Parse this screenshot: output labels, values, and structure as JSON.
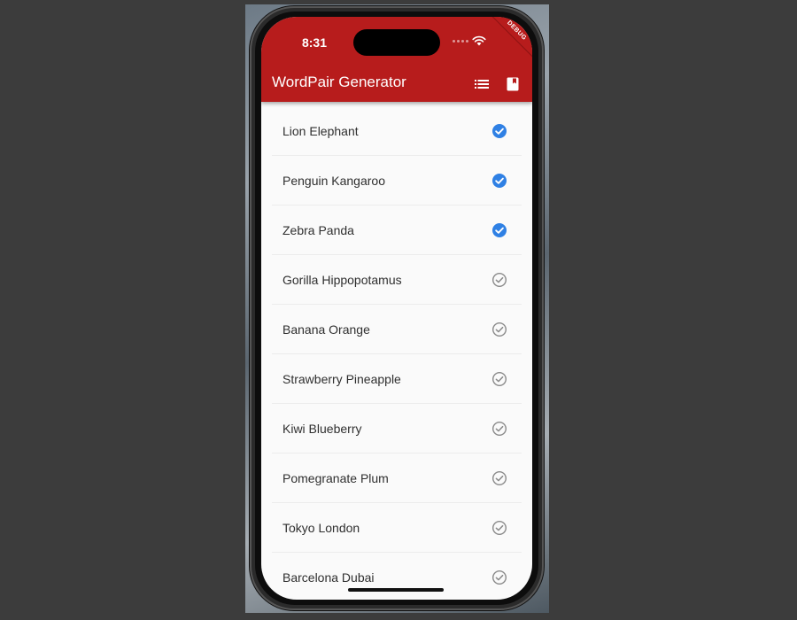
{
  "status": {
    "time": "8:31"
  },
  "debug_banner": "DEBUG",
  "app_bar": {
    "title": "WordPair Generator",
    "actions": [
      {
        "name": "list-icon"
      },
      {
        "name": "book-icon"
      }
    ]
  },
  "colors": {
    "app_bar": "#b71c1c",
    "selected": "#2f80e4",
    "unselected": "#8a8a8a"
  },
  "list": {
    "items": [
      {
        "label": "Lion Elephant",
        "selected": true
      },
      {
        "label": "Penguin Kangaroo",
        "selected": true
      },
      {
        "label": "Zebra Panda",
        "selected": true
      },
      {
        "label": "Gorilla Hippopotamus",
        "selected": false
      },
      {
        "label": "Banana Orange",
        "selected": false
      },
      {
        "label": "Strawberry Pineapple",
        "selected": false
      },
      {
        "label": "Kiwi Blueberry",
        "selected": false
      },
      {
        "label": "Pomegranate Plum",
        "selected": false
      },
      {
        "label": "Tokyo London",
        "selected": false
      },
      {
        "label": "Barcelona Dubai",
        "selected": false
      }
    ]
  }
}
